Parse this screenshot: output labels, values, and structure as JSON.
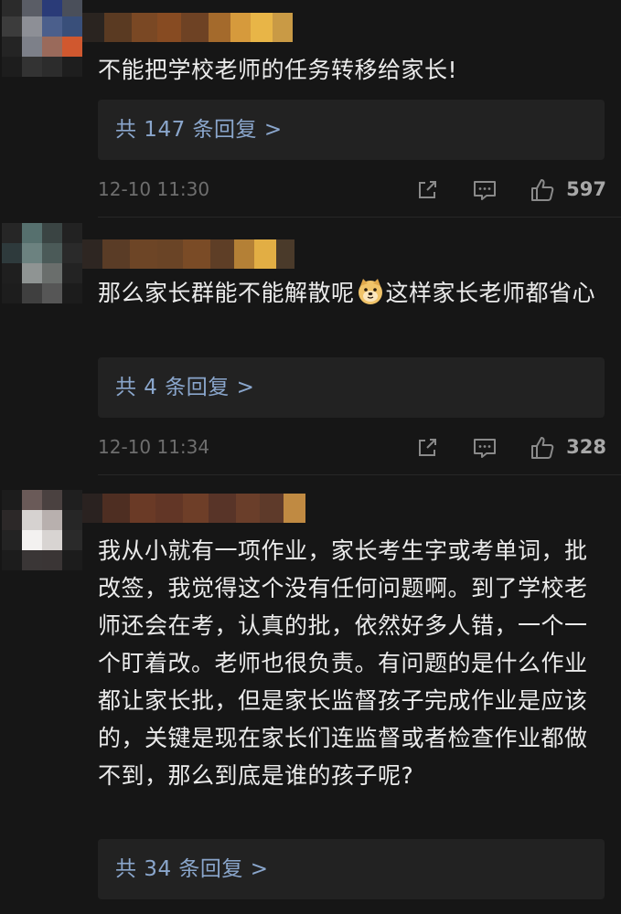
{
  "colors": {
    "background": "#161616",
    "reply_box": "#222222",
    "reply_link": "#8aa6cc",
    "meta_text": "#6e6e6e"
  },
  "comments": [
    {
      "text": "不能把学校老师的任务转移给家长!",
      "reply_label": "共 147 条回复 >",
      "time": "12-10 11:30",
      "likes": "597",
      "icons": [
        "share-icon",
        "comment-icon",
        "like-icon"
      ]
    },
    {
      "text_before_emoji": "那么家长群能不能解散呢",
      "emoji": "doge-emoji",
      "text_after_emoji": "这样家长老师都省心",
      "reply_label": "共 4 条回复 >",
      "time": "12-10 11:34",
      "likes": "328",
      "icons": [
        "share-icon",
        "comment-icon",
        "like-icon"
      ]
    },
    {
      "text": "我从小就有一项作业，家长考生字或考单词，批改签，我觉得这个没有任何问题啊。到了学校老师还会在考，认真的批，依然好多人错，一个一个盯着改。老师也很负责。有问题的是什么作业都让家长批，但是家长监督孩子完成作业是应该的，关键是现在家长们连监督或者检查作业都做不到，那么到底是谁的孩子呢?",
      "reply_label": "共 34 条回复 >"
    }
  ]
}
